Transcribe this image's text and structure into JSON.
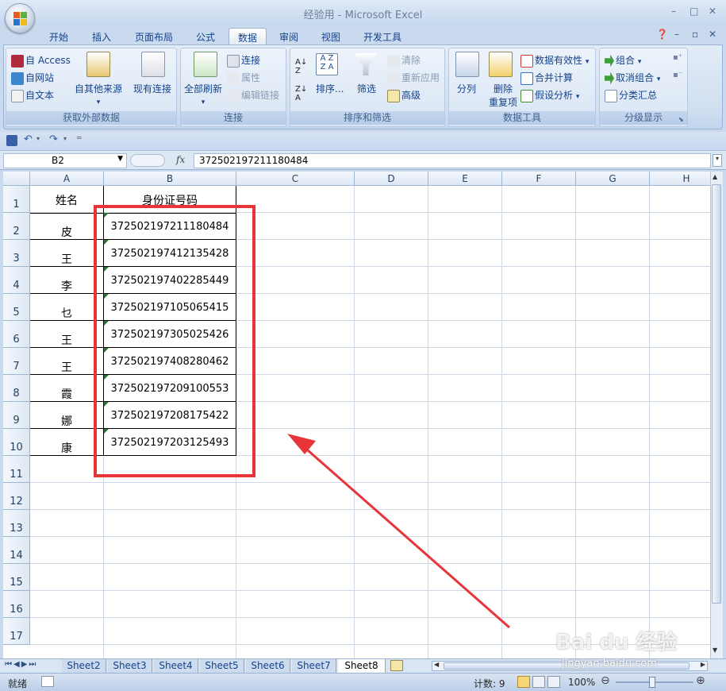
{
  "window": {
    "title": "经验用 - Microsoft Excel",
    "minimize": "–",
    "restore": "□",
    "close": "✕"
  },
  "ribbon_tabs": [
    "开始",
    "插入",
    "页面布局",
    "公式",
    "数据",
    "审阅",
    "视图",
    "开发工具"
  ],
  "active_tab": "数据",
  "ribbon": {
    "external_data": {
      "label": "获取外部数据",
      "access": "自 Access",
      "web": "自网站",
      "text": "自文本",
      "other_sources": "自其他来源",
      "existing": "现有连接"
    },
    "connections": {
      "label": "连接",
      "refresh_all": "全部刷新",
      "connections": "连接",
      "properties": "属性",
      "edit_links": "编辑链接"
    },
    "sort_filter": {
      "label": "排序和筛选",
      "sort": "排序...",
      "filter": "筛选",
      "clear": "清除",
      "reapply": "重新应用",
      "advanced": "高级"
    },
    "data_tools": {
      "label": "数据工具",
      "text_to_columns": "分列",
      "remove_dup_1": "删除",
      "remove_dup_2": "重复项",
      "validation": "数据有效性",
      "consolidate": "合并计算",
      "what_if": "假设分析"
    },
    "outline": {
      "label": "分级显示",
      "group": "组合",
      "ungroup": "取消组合",
      "subtotal": "分类汇总"
    }
  },
  "formula_bar": {
    "name_box": "B2",
    "fx": "fx",
    "value": "372502197211180484"
  },
  "columns": [
    "A",
    "B",
    "C",
    "D",
    "E",
    "F",
    "G",
    "H"
  ],
  "rows": [
    "1",
    "2",
    "3",
    "4",
    "5",
    "6",
    "7",
    "8",
    "9",
    "10",
    "11",
    "12",
    "13",
    "14",
    "15",
    "16",
    "17"
  ],
  "table": {
    "header_name": "姓名",
    "header_id": "身份证号码",
    "names": [
      "皮",
      "王",
      "李",
      "乜",
      "王",
      "王",
      "霞",
      "娜",
      "康"
    ],
    "ids": [
      "372502197211180484",
      "372502197412135428",
      "372502197402285449",
      "372502197105065415",
      "372502197305025426",
      "372502197408280462",
      "372502197209100553",
      "372502197208175422",
      "372502197203125493"
    ]
  },
  "sheets": [
    "Sheet2",
    "Sheet3",
    "Sheet4",
    "Sheet5",
    "Sheet6",
    "Sheet7",
    "Sheet8"
  ],
  "active_sheet": "Sheet8",
  "status": {
    "ready": "就绪",
    "count": "计数: 9",
    "zoom": "100%"
  },
  "watermark": {
    "brand": "Bai du 经验",
    "url": "jingyan.baidu.com"
  },
  "colors": {
    "annotation": "#e8353a",
    "ribbon": "#d8e5f4",
    "grid_line": "#d0d7e5"
  }
}
